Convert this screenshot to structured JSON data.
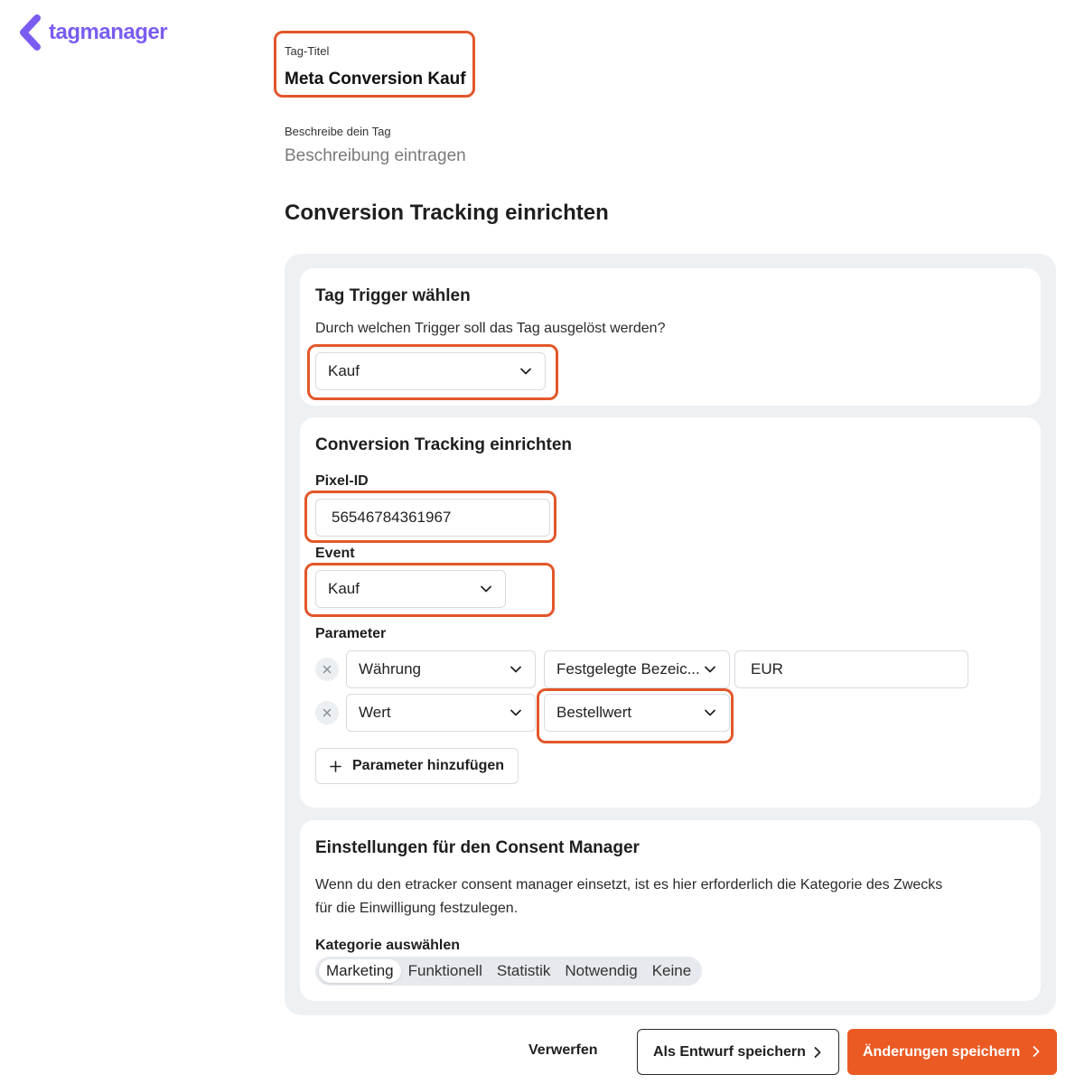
{
  "brand": {
    "name": "tagmanager",
    "color": "#7b5cf0",
    "icon": "chevron-left-logo-icon"
  },
  "tag": {
    "title_label": "Tag-Titel",
    "title_value": "Meta Conversion Kauf"
  },
  "description": {
    "label": "Beschreibe dein Tag",
    "placeholder": "Beschreibung eintragen"
  },
  "section_title": "Conversion Tracking einrichten",
  "trigger": {
    "title": "Tag Trigger wählen",
    "question": "Durch welchen Trigger soll das Tag ausgelöst werden?",
    "selected": "Kauf"
  },
  "conversion": {
    "title": "Conversion Tracking einrichten",
    "pixel_label": "Pixel-ID",
    "pixel_value": "56546784361967",
    "event_label": "Event",
    "event_selected": "Kauf",
    "parameter_label": "Parameter",
    "parameters": [
      {
        "name": "Währung",
        "type": "Festgelegte Bezeic...",
        "value": "EUR"
      },
      {
        "name": "Wert",
        "type": "Bestellwert"
      }
    ],
    "add_parameter_label": "Parameter hinzufügen"
  },
  "consent": {
    "title": "Einstellungen für den Consent Manager",
    "text_line1": "Wenn du den etracker consent manager einsetzt, ist es hier erforderlich die Kategorie des Zwecks",
    "text_line2": "für die Einwilligung festzulegen.",
    "category_label": "Kategorie auswählen",
    "categories": [
      "Marketing",
      "Funktionell",
      "Statistik",
      "Notwendig",
      "Keine"
    ],
    "selected_category": "Marketing"
  },
  "footer": {
    "discard_label": "Verwerfen",
    "draft_label": "Als Entwurf speichern",
    "save_label": "Änderungen speichern"
  },
  "colors": {
    "accent": "#eb5a23",
    "highlight": "#e2572a",
    "panel_bg": "#eef1f4"
  }
}
